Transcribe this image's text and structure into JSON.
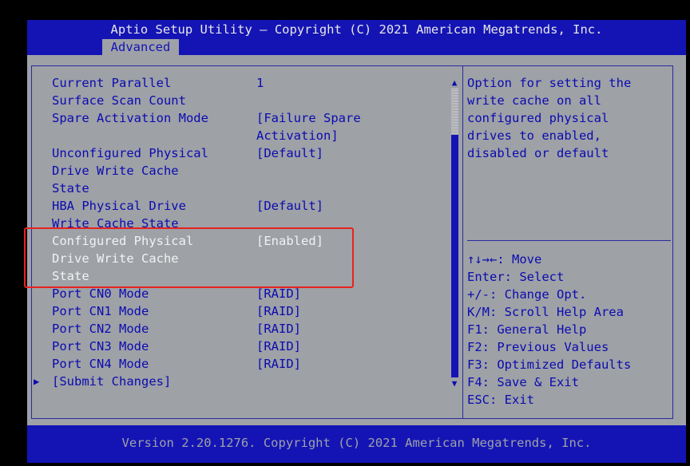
{
  "header": {
    "title": "Aptio Setup Utility – Copyright (C) 2021 American Megatrends, Inc.",
    "active_tab": "Advanced"
  },
  "settings": [
    {
      "label": [
        "Current Parallel",
        "Surface Scan Count"
      ],
      "value": [
        "1"
      ]
    },
    {
      "label": [
        "Spare Activation Mode"
      ],
      "value": [
        "[Failure Spare",
        "Activation]"
      ]
    },
    {
      "label": [
        "Unconfigured Physical",
        "Drive Write Cache",
        "State"
      ],
      "value": [
        "[Default]"
      ]
    },
    {
      "label": [
        "HBA Physical Drive",
        "Write Cache State"
      ],
      "value": [
        "[Default]"
      ]
    },
    {
      "label": [
        "Configured Physical",
        "Drive Write Cache",
        "State"
      ],
      "value": [
        "[Enabled]"
      ],
      "selected": true
    },
    {
      "label": [
        "Port CN0 Mode"
      ],
      "value": [
        "[RAID]"
      ]
    },
    {
      "label": [
        "Port CN1 Mode"
      ],
      "value": [
        "[RAID]"
      ]
    },
    {
      "label": [
        "Port CN2 Mode"
      ],
      "value": [
        "[RAID]"
      ]
    },
    {
      "label": [
        "Port CN3 Mode"
      ],
      "value": [
        "[RAID]"
      ]
    },
    {
      "label": [
        "Port CN4 Mode"
      ],
      "value": [
        "[RAID]"
      ]
    },
    {
      "label": [
        "[Submit Changes]"
      ],
      "value": [],
      "submenu": true
    }
  ],
  "help": {
    "lines": [
      "Option for setting the",
      "write cache on all",
      "configured physical",
      "drives to enabled,",
      "disabled or default"
    ]
  },
  "keys": [
    "↑↓→←: Move",
    "Enter: Select",
    "+/-: Change Opt.",
    "K/M: Scroll Help Area",
    "F1: General Help",
    "F2: Previous Values",
    "F3: Optimized Defaults",
    "F4: Save & Exit",
    "ESC: Exit"
  ],
  "footer": {
    "version": "Version 2.20.1276. Copyright (C) 2021 American Megatrends, Inc."
  },
  "icons": {
    "scroll_up": "up-triangle",
    "scroll_down": "down-triangle",
    "submenu": "right-triangle"
  },
  "colors": {
    "bar_blue": "#1414b5",
    "panel_gray": "#9ea1a6",
    "text_blue": "#0b0bb0",
    "selected_text": "#f2f2f2",
    "annotation_red": "#e8221f"
  }
}
